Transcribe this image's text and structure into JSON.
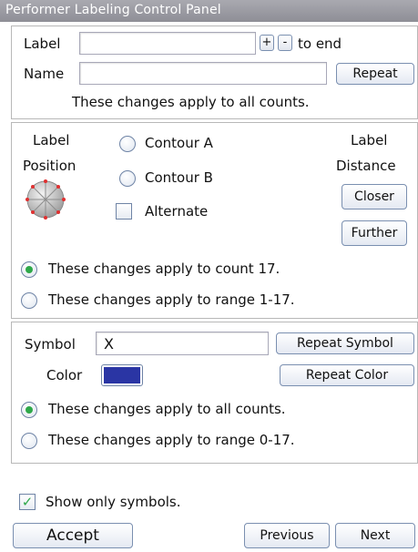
{
  "window": {
    "title": "Performer Labeling Control Panel"
  },
  "label_section": {
    "label_caption": "Label",
    "label_value": "",
    "plus_label": "+",
    "minus_label": "-",
    "to_end_text": "to end",
    "name_caption": "Name",
    "name_value": "",
    "repeat_label": "Repeat",
    "scope_text": "These changes apply to all counts."
  },
  "position_section": {
    "label_position_caption_1": "Label",
    "label_position_caption_2": "Position",
    "contour_a_label": "Contour A",
    "contour_b_label": "Contour B",
    "alternate_label": "Alternate",
    "distance_caption_1": "Label",
    "distance_caption_2": "Distance",
    "closer_label": "Closer",
    "further_label": "Further",
    "scope_count_text": "These changes apply to count 17.",
    "scope_range_text": "These changes apply to range 1-17.",
    "selected_scope": "count"
  },
  "symbol_section": {
    "symbol_caption": "Symbol",
    "symbol_value": "X",
    "repeat_symbol_label": "Repeat Symbol",
    "color_caption": "Color",
    "color_value": "#2a35a4",
    "repeat_color_label": "Repeat Color",
    "scope_all_text": "These changes apply to all counts.",
    "scope_range_text": "These changes apply to range 0-17.",
    "selected_scope": "all"
  },
  "footer": {
    "show_only_symbols_label": "Show only symbols.",
    "show_only_symbols_checked": true,
    "accept_label": "Accept",
    "previous_label": "Previous",
    "next_label": "Next"
  },
  "colors": {
    "accent_green": "#2ea84a",
    "swatch_blue": "#2a35a4",
    "dial_dots": "#e03030"
  }
}
